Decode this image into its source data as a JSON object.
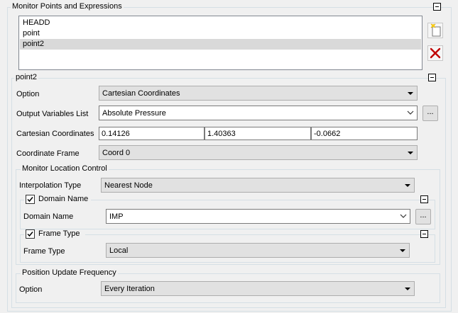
{
  "monitor_panel": {
    "title": "Monitor Points and Expressions",
    "items": [
      {
        "label": "HEADD",
        "selected": false
      },
      {
        "label": "point",
        "selected": false
      },
      {
        "label": "point2",
        "selected": true
      }
    ],
    "new_icon": "new-item-icon",
    "delete_icon": "delete-icon"
  },
  "point_panel": {
    "title": "point2",
    "option_label": "Option",
    "option_value": "Cartesian Coordinates",
    "output_vars_label": "Output Variables List",
    "output_vars_value": "Absolute Pressure",
    "browse_label": "...",
    "coords_label": "Cartesian Coordinates",
    "coords": [
      "0.14126",
      "1.40363",
      "-0.0662"
    ],
    "frame_label": "Coordinate Frame",
    "frame_value": "Coord 0"
  },
  "location_control": {
    "title": "Monitor Location Control",
    "interp_label": "Interpolation Type",
    "interp_value": "Nearest Node",
    "domain_group": {
      "checked": true,
      "title": "Domain Name",
      "label": "Domain Name",
      "value": "IMP",
      "browse_label": "..."
    },
    "frame_group": {
      "checked": true,
      "title": "Frame Type",
      "label": "Frame Type",
      "value": "Local"
    }
  },
  "update_frequency": {
    "title": "Position Update Frequency",
    "option_label": "Option",
    "option_value": "Every Iteration"
  }
}
